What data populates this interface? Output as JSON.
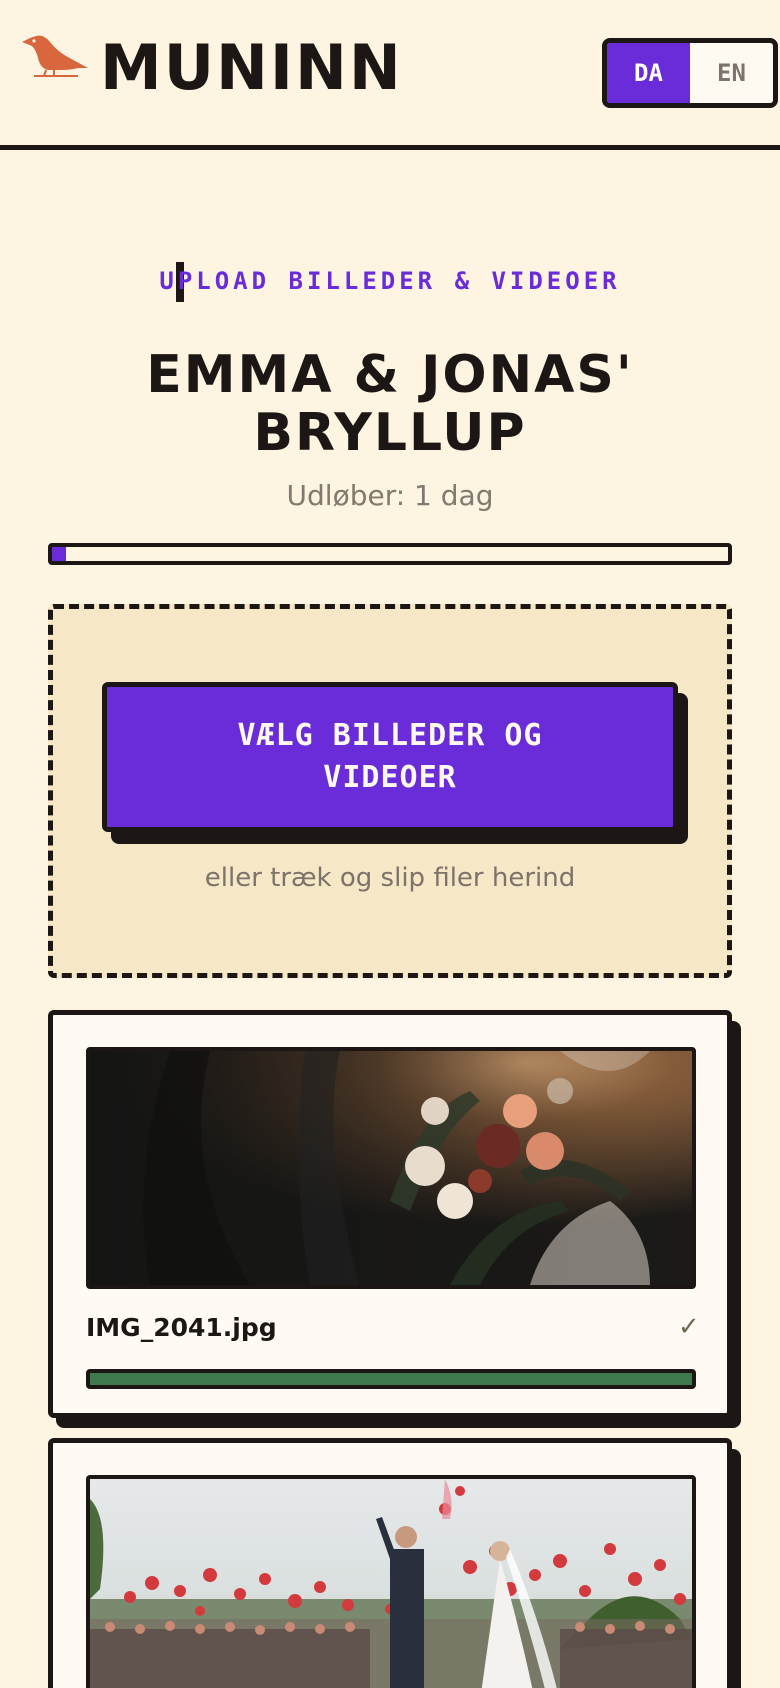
{
  "header": {
    "brand": "MUNINN",
    "languages": [
      {
        "code": "DA",
        "active": true
      },
      {
        "code": "EN",
        "active": false
      }
    ]
  },
  "upload": {
    "eyebrow": "UPLOAD BILLEDER & VIDEOER",
    "title": "EMMA & JONAS' BRYLLUP",
    "expiry": "Udløber: 1 dag",
    "expiry_progress": 0.02,
    "pick_button": "VÆLG BILLEDER OG VIDEOER",
    "drop_hint": "eller træk og slip filer herind"
  },
  "files": [
    {
      "name": "IMG_2041.jpg",
      "status_icon": "✓",
      "progress": 1.0,
      "thumbnail": "bouquet-photo"
    },
    {
      "name": "",
      "status_icon": "",
      "progress": null,
      "thumbnail": "balloons-photo"
    }
  ],
  "colors": {
    "background": "#fdf4e1",
    "accent": "#6a2bd9",
    "ink": "#1c1714",
    "success": "#3e7a4e",
    "muted": "#817a70"
  }
}
